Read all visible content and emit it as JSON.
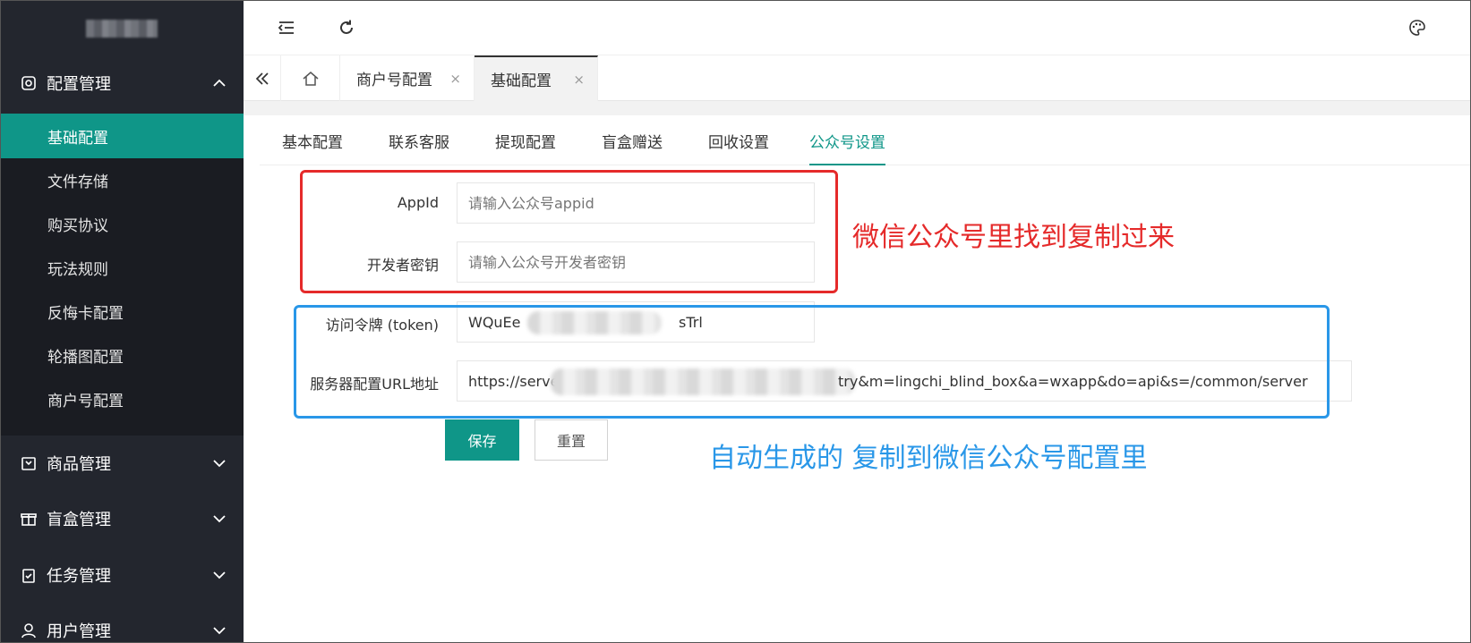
{
  "sidebar": {
    "groups": [
      {
        "label": "配置管理",
        "icon": "settings-icon",
        "expanded": true
      },
      {
        "label": "商品管理",
        "icon": "package-icon",
        "expanded": false
      },
      {
        "label": "盲盒管理",
        "icon": "gift-icon",
        "expanded": false
      },
      {
        "label": "任务管理",
        "icon": "clipboard-check-icon",
        "expanded": false
      },
      {
        "label": "用户管理",
        "icon": "user-icon",
        "expanded": false
      }
    ],
    "submenu": [
      {
        "label": "基础配置",
        "active": true
      },
      {
        "label": "文件存储"
      },
      {
        "label": "购买协议"
      },
      {
        "label": "玩法规则"
      },
      {
        "label": "反悔卡配置"
      },
      {
        "label": "轮播图配置"
      },
      {
        "label": "商户号配置"
      }
    ]
  },
  "header": {
    "icons": [
      "menu-fold-icon",
      "refresh-icon",
      "palette-icon"
    ]
  },
  "tabs": [
    {
      "label": "商户号配置",
      "close": "×"
    },
    {
      "label": "基础配置",
      "close": "×",
      "active": true
    }
  ],
  "subtabs": [
    "基本配置",
    "联系客服",
    "提现配置",
    "盲盒赠送",
    "回收设置",
    "公众号设置"
  ],
  "subtab_active": "公众号设置",
  "form": {
    "appid": {
      "label": "AppId",
      "placeholder": "请输入公众号appid"
    },
    "secret": {
      "label": "开发者密钥",
      "placeholder": "请输入公众号开发者密钥"
    },
    "token": {
      "label": "访问令牌 (token)",
      "value_start": "WQuEe",
      "value_end": "sTrl"
    },
    "url": {
      "label": "服务器配置URL地址",
      "value_start": "https://serve",
      "value_end": "try&m=lingchi_blind_box&a=wxapp&do=api&s=/common/server"
    },
    "save": "保存",
    "reset": "重置"
  },
  "annotations": {
    "red": "微信公众号里找到复制过来",
    "blue": "自动生成的  复制到微信公众号配置里"
  },
  "colors": {
    "sidebar_bg": "#23262e",
    "accent": "#0f9688",
    "annotation_red": "#e52a2a",
    "annotation_blue": "#2997e8"
  }
}
